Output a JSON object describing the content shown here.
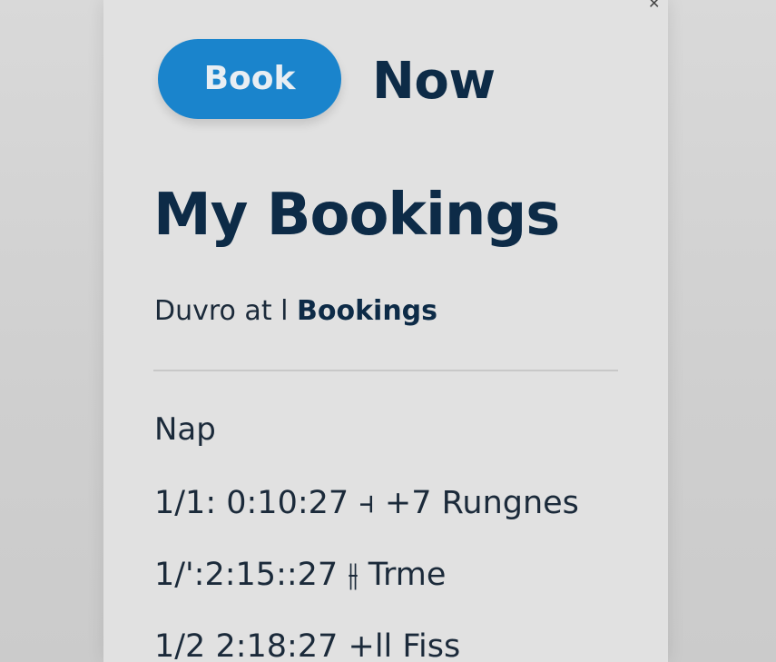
{
  "header": {
    "book_button_label": "Book",
    "now_label": "Now"
  },
  "page": {
    "title": "My Bookings",
    "subtitle_prefix": "Duvro at l",
    "subtitle_strong": "Bookings"
  },
  "section": {
    "label": "Nap"
  },
  "bookings": [
    {
      "text": "1/1: 0:10:27 ⫞ +7 Rungnes"
    },
    {
      "text": "1/':2:15::27 ⫲ Trme"
    },
    {
      "text": "1/2 2:18:27 +ll Fiss"
    }
  ],
  "icons": {
    "close": "close-icon"
  },
  "colors": {
    "accent": "#1a84cc",
    "title": "#0d2b47",
    "panel_bg": "#e1e1e1",
    "page_bg": "#d3d3d3"
  }
}
